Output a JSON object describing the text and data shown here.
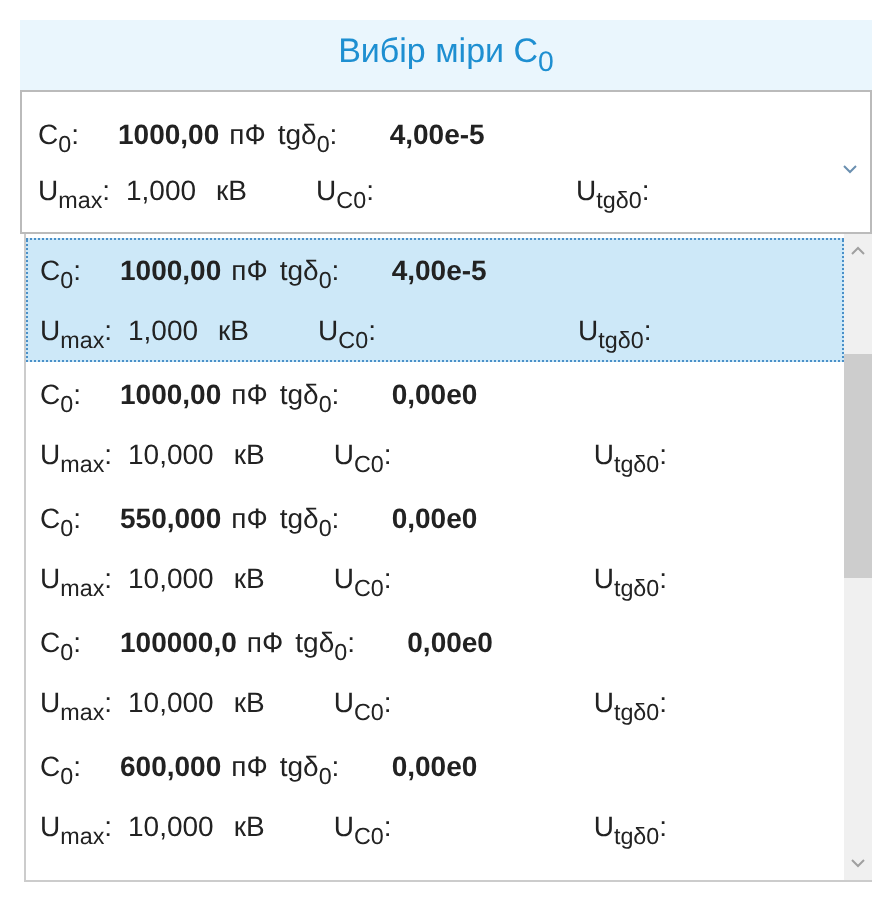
{
  "title": "Вибір міри C$_{0}$",
  "combobox": {
    "expanded": true,
    "value": {
      "c0_label": "C$_{0}$:",
      "c0": "1000,00",
      "c0_unit": "пФ",
      "tg_label": "tgδ$_{0}$:",
      "tg": "4,00e-5",
      "umax_label": "U$_{max}$:",
      "umax": "1,000",
      "umax_unit": "кВ",
      "uc0_label": "U$_{C0}$:",
      "utg_label": "U$_{tgδ0}$:"
    }
  },
  "items": [
    {
      "selected": true,
      "c0_label": "C$_{0}$:",
      "c0": "1000,00",
      "c0_unit": "пФ",
      "tg_label": "tgδ$_{0}$:",
      "tg": "4,00e-5",
      "umax_label": "U$_{max}$:",
      "umax": "1,000",
      "umax_unit": "кВ",
      "uc0_label": "U$_{C0}$:",
      "utg_label": "U$_{tgδ0}$:"
    },
    {
      "selected": false,
      "c0_label": "C$_{0}$:",
      "c0": "1000,00",
      "c0_unit": "пФ",
      "tg_label": "tgδ$_{0}$:",
      "tg": "0,00e0",
      "umax_label": "U$_{max}$:",
      "umax": "10,000",
      "umax_unit": "кВ",
      "uc0_label": "U$_{C0}$:",
      "utg_label": "U$_{tgδ0}$:"
    },
    {
      "selected": false,
      "c0_label": "C$_{0}$:",
      "c0": "550,000",
      "c0_unit": "пФ",
      "tg_label": "tgδ$_{0}$:",
      "tg": "0,00e0",
      "umax_label": "U$_{max}$:",
      "umax": "10,000",
      "umax_unit": "кВ",
      "uc0_label": "U$_{C0}$:",
      "utg_label": "U$_{tgδ0}$:"
    },
    {
      "selected": false,
      "c0_label": "C$_{0}$:",
      "c0": "100000,0",
      "c0_unit": "пФ",
      "tg_label": "tgδ$_{0}$:",
      "tg": "0,00e0",
      "umax_label": "U$_{max}$:",
      "umax": "10,000",
      "umax_unit": "кВ",
      "uc0_label": "U$_{C0}$:",
      "utg_label": "U$_{tgδ0}$:"
    },
    {
      "selected": false,
      "c0_label": "C$_{0}$:",
      "c0": "600,000",
      "c0_unit": "пФ",
      "tg_label": "tgδ$_{0}$:",
      "tg": "0,00e0",
      "umax_label": "U$_{max}$:",
      "umax": "10,000",
      "umax_unit": "кВ",
      "uc0_label": "U$_{C0}$:",
      "utg_label": "U$_{tgδ0}$:"
    }
  ]
}
